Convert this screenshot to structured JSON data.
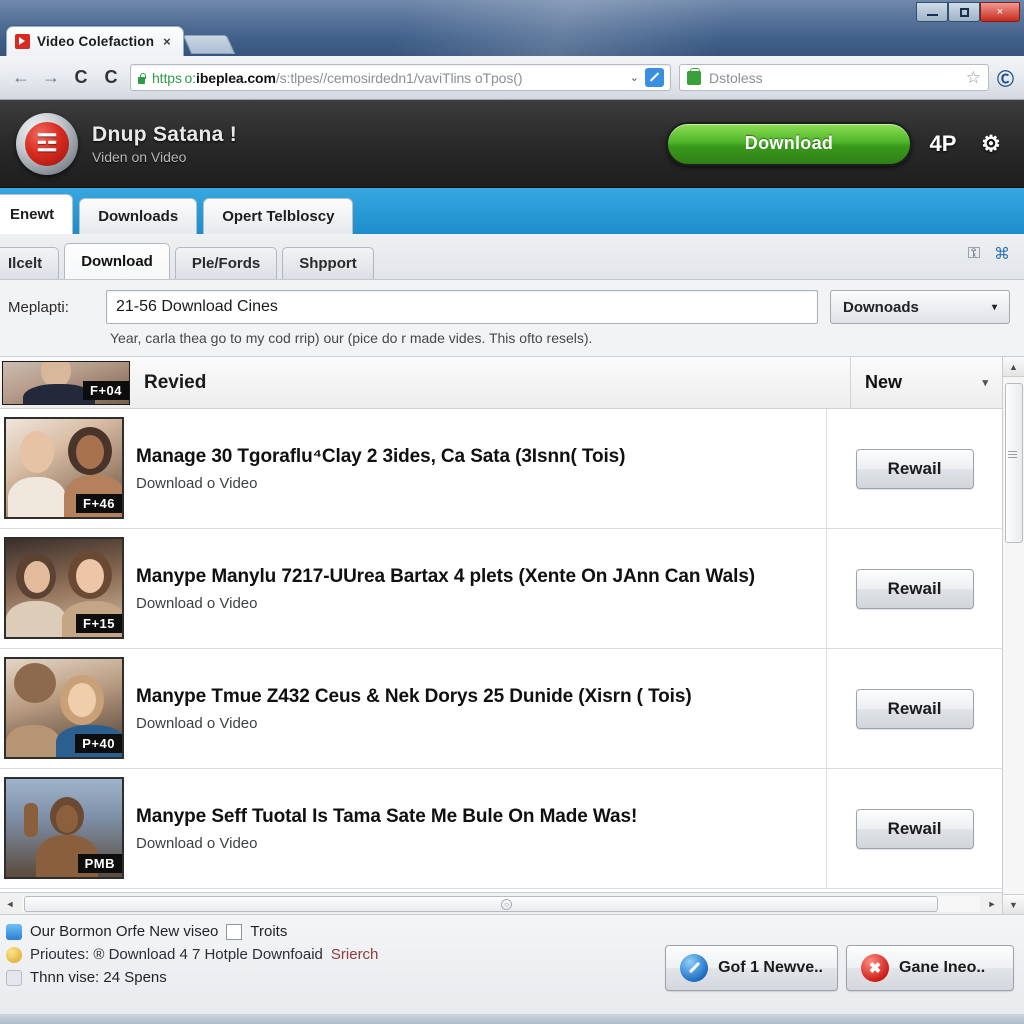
{
  "browser": {
    "tab": {
      "title": "Video Colefaction",
      "close_label": "×",
      "favicon": "video-play-favicon"
    },
    "newtab_name": "new-tab-button",
    "window_controls": {
      "minimize": "minimize",
      "maximize": "maximize",
      "close": "×"
    },
    "nav": {
      "back": "←",
      "forward": "→",
      "reload": "C",
      "reload2": "C"
    },
    "omnibox": {
      "scheme": "https o:",
      "host": "ibeplea.com",
      "path": "/s:tlpes//cemosirdedn1/vaviTlins oTpos()",
      "caret": "⌄",
      "edit_button": "edit-omnibox-button"
    },
    "searchbox": {
      "placeholder": "Dstoless",
      "icon": "shopping-bag-icon"
    },
    "star": "☆",
    "menu": "Ⓒ"
  },
  "app": {
    "brand": {
      "name": "Dnup Satana !",
      "tagline": "Viden on Video",
      "logo": "☲"
    },
    "download_cta": "Download",
    "header_icons": {
      "account": "4P",
      "settings": "⚙"
    },
    "primary_tabs": [
      {
        "label": "Enewt",
        "active": true
      },
      {
        "label": "Downloads",
        "active": false
      },
      {
        "label": "Opert Telbloscy",
        "active": false
      }
    ],
    "secondary_tabs": [
      {
        "label": "Ilcelt",
        "active": false
      },
      {
        "label": "Download",
        "active": true
      },
      {
        "label": "Ple/Fords",
        "active": false
      },
      {
        "label": "Shpport",
        "active": false
      }
    ],
    "secondary_icons": {
      "lock": "⚿",
      "share": "⌘"
    },
    "form": {
      "label": "Meplapti:",
      "input_value": "21-56 Download Cines",
      "hint": "Year, carla thea go to my cod rrip) our (pice do r made vides. This ofto resels).",
      "filter_button": {
        "label": "Downoads",
        "caret": "▾"
      }
    },
    "list_header": {
      "title": "Revied",
      "badge": "F+04",
      "sort": {
        "label": "New",
        "caret": "▾"
      }
    },
    "items": [
      {
        "badge": "F+46",
        "title": "Manage 30 Tgoraflu⁴Clay 2 3ides, Ca Sata (3Isnn( Tois)",
        "subtitle": "Download o Video",
        "action": "Rewail"
      },
      {
        "badge": "F+15",
        "title": "Manype Manylu 7217-UUrea Bartax 4 plets (Xente On JAnn Can Wals)",
        "subtitle": "Download o Video",
        "action": "Rewail"
      },
      {
        "badge": "P+40",
        "title": "Manype Tmue Z432 Ceus & Nek Dorys 25 Dunide (Xisrn ( Tois)",
        "subtitle": "Download o Video",
        "action": "Rewail"
      },
      {
        "badge": "PMB",
        "title": "Manype Seff Tuotal Is Tama Sate Me Bule On Made Was!",
        "subtitle": "Download o Video",
        "action": "Rewail"
      }
    ],
    "scrollbars": {
      "v_up": "▲",
      "v_down": "▼",
      "h_left": "◄",
      "h_right": "►",
      "h_grip": "○"
    },
    "footer": {
      "line1": "Our Bormon Orfe New viseo",
      "checkbox_label": "Troits",
      "line2_a": "Prioutes: ® Download 4 7 Hotple Downfoaid ",
      "line2_b": "Srierch",
      "line3": "Thnn vise: 24 Spens",
      "buttons": [
        {
          "label": "Gof 1 Newve..",
          "icon": "pencil-circle-icon"
        },
        {
          "label": "Gane Ineo..",
          "icon": "alert-circle-icon",
          "glyph": "✖"
        }
      ]
    }
  }
}
